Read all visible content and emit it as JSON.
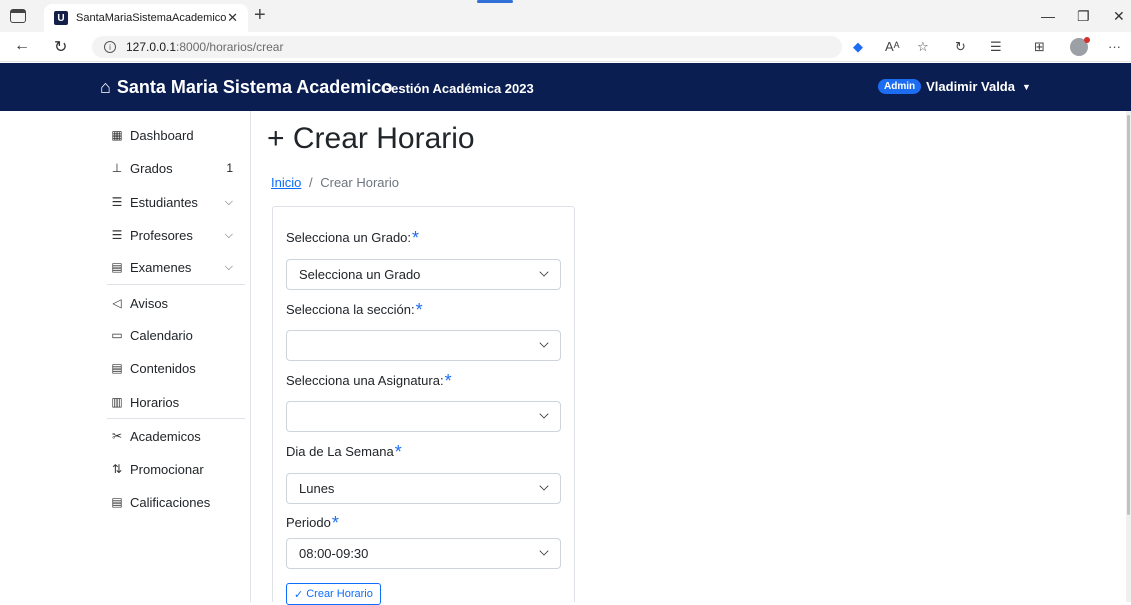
{
  "browser": {
    "tab_title": "SantaMariaSistemaAcademico",
    "tab_favicon": "U",
    "url_host": "127.0.0.1",
    "url_path": ":8000/horarios/crear"
  },
  "navbar": {
    "brand": "Santa Maria Sistema Academico",
    "subtitle": "Gestión Académica 2023",
    "badge": "Admin",
    "user": "Vladimir Valda",
    "bg_color": "#0a1e52"
  },
  "sidebar": {
    "items": [
      {
        "label": "Dashboard",
        "icon": "grid-icon"
      },
      {
        "label": "Grados",
        "icon": "diagram-icon",
        "count": "1"
      },
      {
        "label": "Estudiantes",
        "icon": "person-lines-icon"
      },
      {
        "label": "Profesores",
        "icon": "person-lines-icon"
      },
      {
        "label": "Examenes",
        "icon": "document-icon"
      },
      {
        "label": "Avisos",
        "icon": "megaphone-icon"
      },
      {
        "label": "Calendario",
        "icon": "calendar-icon"
      },
      {
        "label": "Contenidos",
        "icon": "file-text-icon"
      },
      {
        "label": "Horarios",
        "icon": "table-icon"
      },
      {
        "label": "Academicos",
        "icon": "tools-icon"
      },
      {
        "label": "Promocionar",
        "icon": "sort-arrows-icon"
      },
      {
        "label": "Calificaciones",
        "icon": "card-list-icon"
      }
    ]
  },
  "main": {
    "title_icon": "+",
    "title": "Crear Horario",
    "breadcrumb_home": "Inicio",
    "breadcrumb_sep": "/",
    "breadcrumb_current": "Crear Horario"
  },
  "form": {
    "grado_label": "Selecciona un Grado:",
    "grado_value": "Selecciona un Grado",
    "seccion_label": "Selecciona la sección:",
    "seccion_value": "",
    "asignatura_label": "Selecciona una Asignatura:",
    "asignatura_value": "",
    "dia_label": "Dia de La Semana",
    "dia_value": "Lunes",
    "periodo_label": "Periodo",
    "periodo_value": "08:00-09:30",
    "required_mark": "*",
    "submit_label": "Crear Horario"
  }
}
